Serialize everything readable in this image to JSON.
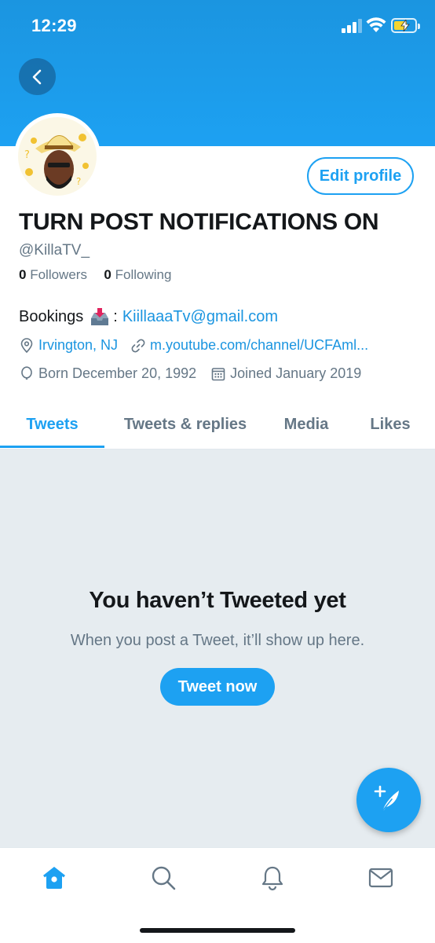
{
  "status_bar": {
    "time": "12:29"
  },
  "header": {
    "back_label": "Back"
  },
  "profile": {
    "edit_label": "Edit profile",
    "display_name": "TURN POST NOTIFICATIONS ON",
    "handle": "@KillaTV_",
    "followers_count": "0",
    "followers_label": "Followers",
    "following_count": "0",
    "following_label": "Following",
    "bio_prefix": "Bookings",
    "bio_separator": ":",
    "bio_email": "KiillaaaTv@gmail.com",
    "location": "Irvington, NJ",
    "website": "m.youtube.com/channel/UCFAml...",
    "birthday": "Born December 20, 1992",
    "joined": "Joined January 2019"
  },
  "tabs": [
    {
      "label": "Tweets",
      "active": true
    },
    {
      "label": "Tweets & replies",
      "active": false
    },
    {
      "label": "Media",
      "active": false
    },
    {
      "label": "Likes",
      "active": false
    }
  ],
  "empty_state": {
    "title": "You haven’t Tweeted yet",
    "subtitle": "When you post a Tweet, it’ll show up here.",
    "button_label": "Tweet now"
  },
  "bottom_nav": [
    "home-icon",
    "search-icon",
    "bell-icon",
    "mail-icon"
  ],
  "colors": {
    "accent": "#1da1f2",
    "text": "#14171a",
    "secondary": "#657786",
    "background_empty": "#e6ecf0"
  }
}
